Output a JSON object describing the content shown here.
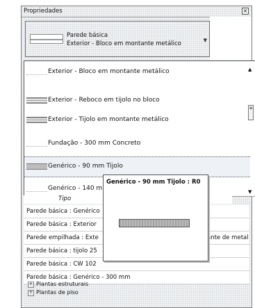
{
  "panel": {
    "title": "Propriedades",
    "close_glyph": "×"
  },
  "type_selector": {
    "line1": "Parede básica",
    "line2": "Exterior - Bloco em montante metálico",
    "dropdown_icon": "chevron-down-icon"
  },
  "type_list": {
    "items": [
      {
        "label": "Exterior - Bloco em montante metálico",
        "swatch": "thin"
      },
      {
        "label": "Exterior - Reboco em tijolo no bloco",
        "swatch": "brick"
      },
      {
        "label": "Exterior - Tijolo em montante metálico",
        "swatch": "brick"
      },
      {
        "label": "Fundação - 300 mm Concreto",
        "swatch": "thin"
      },
      {
        "label": "Genérico - 90 mm Tijolo",
        "swatch": "solid"
      },
      {
        "label": "Genérico - 140 m",
        "swatch": "thin"
      }
    ],
    "selected_index": 4
  },
  "column_header": "Tipo",
  "table_rows": [
    {
      "left": "Parede básica : Genérico",
      "right": ""
    },
    {
      "left": "Parede básica : Exterior",
      "right": ""
    },
    {
      "left": "Parede empilhada : Exte",
      "right": "ante de metal"
    },
    {
      "left": "Parede básica : tijolo 25",
      "right": ""
    },
    {
      "left": "Parede básica : CW 102",
      "right": ""
    },
    {
      "left": "Parede básica : Genérico - 300 mm",
      "right": ""
    }
  ],
  "tree": [
    {
      "label": "Plantas estruturais"
    },
    {
      "label": "Plantas de piso"
    }
  ],
  "tooltip": {
    "title": "Genérico - 90 mm Tijolo : R0"
  }
}
